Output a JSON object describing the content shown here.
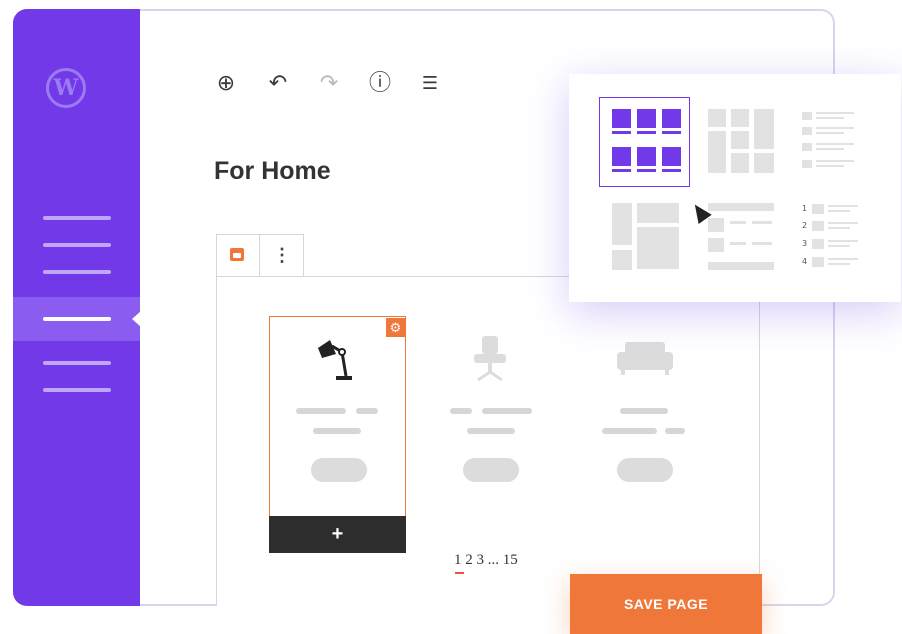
{
  "sidebar": {
    "logo_label": "W"
  },
  "toolbar": {
    "items": [
      {
        "name": "add-block",
        "glyph": "⊕"
      },
      {
        "name": "undo",
        "glyph": "↶"
      },
      {
        "name": "redo",
        "glyph": "↷"
      },
      {
        "name": "info",
        "glyph": "ⓘ"
      },
      {
        "name": "outline",
        "glyph": "☰"
      }
    ]
  },
  "page": {
    "title": "For Home"
  },
  "block_toolbar": {
    "more_glyph": "⋮"
  },
  "products": {
    "gear_glyph": "⚙",
    "add_label": "+"
  },
  "pagination": {
    "text": "1 2 3 ... 15"
  },
  "layout_picker": {
    "list_numbers": [
      "1",
      "2",
      "3",
      "4"
    ]
  },
  "actions": {
    "save_label": "SAVE PAGE"
  },
  "colors": {
    "accent_purple": "#7139e8",
    "accent_orange": "#f0773a"
  }
}
